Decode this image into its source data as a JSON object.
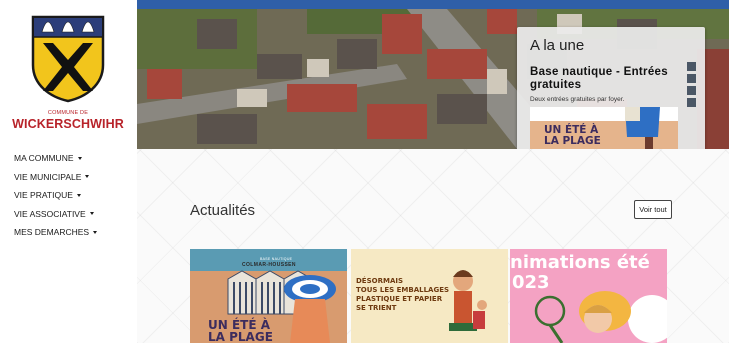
{
  "site": {
    "commune_prefix": "COMMUNE DE",
    "commune_name": "WICKERSCHWIHR"
  },
  "nav": {
    "items": [
      {
        "label": "MA COMMUNE"
      },
      {
        "label": "VIE MUNICIPALE"
      },
      {
        "label": "VIE PRATIQUE"
      },
      {
        "label": "VIE ASSOCIATIVE"
      },
      {
        "label": "MES DEMARCHES"
      }
    ]
  },
  "alaune": {
    "title": "A la une",
    "headline": "Base nautique - Entrées gratuites",
    "subtitle": "Deux entrées gratuites par foyer.",
    "image_text": "UN ÉTÉ À\nLA PLAGE"
  },
  "news": {
    "heading": "Actualités",
    "see_all": "Voir tout",
    "cards": [
      {
        "top_small": "BASE NAUTIQUE",
        "top_title": "COLMAR-HOUSSEN",
        "text": "UN ÉTÉ À\nLA PLAGE"
      },
      {
        "text": "DÉSORMAIS\nTOUS LES EMBALLAGES\nPLASTIQUE ET PAPIER\nSE TRIENT"
      },
      {
        "title": "nimations été",
        "year": "023"
      }
    ]
  },
  "colors": {
    "topbar": "#2f5fa8",
    "brand_red": "#b8232a",
    "shield_yellow": "#f2c51c"
  }
}
